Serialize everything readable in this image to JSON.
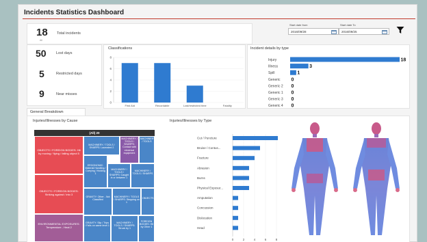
{
  "header": {
    "title": "Incidents Statistics Dashboard"
  },
  "stats": {
    "total": {
      "value": "18",
      "label": "Total incidents",
      "sub": "All"
    },
    "lost_days": {
      "value": "50",
      "label": "Lost days"
    },
    "restricted_days": {
      "value": "5",
      "label": "Restricted days"
    },
    "near_misses": {
      "value": "9",
      "label": "Near misses"
    }
  },
  "dates": {
    "start_from_label": "Start date from",
    "start_from_value": "2016/09/28",
    "start_to_label": "Start date To",
    "start_to_value": "2016/09/25"
  },
  "classifications": {
    "title": "Classifications",
    "chart_data": {
      "type": "bar",
      "categories": [
        "First Aid",
        "Recordable",
        "Lost/restricted time",
        "Fatality"
      ],
      "values": [
        7,
        7,
        3,
        0
      ],
      "ylim": [
        0,
        8
      ],
      "yticks": [
        "0",
        "2",
        "4",
        "6",
        "8"
      ]
    }
  },
  "incident_details": {
    "title": "Incident details by type",
    "chart_data": {
      "type": "bar",
      "categories": [
        "Injury",
        "Illness",
        "Spill",
        "Generic",
        "Generic 2",
        "Generic 1",
        "Generic 3",
        "Generic 4"
      ],
      "values": [
        18,
        3,
        1,
        0,
        0,
        0,
        0,
        0
      ],
      "value_labels": [
        "18",
        "3",
        "1",
        "0",
        "0",
        "0",
        "0",
        "0"
      ],
      "xlim": [
        0,
        18
      ]
    }
  },
  "general_breakdown": {
    "tab_label": "General Breakdown"
  },
  "treemap": {
    "title": "Injuries/Illnesses by Cause",
    "header": "(All) 20",
    "cells": [
      {
        "text": "OBJECTS / FOREIGN BODIES: Hit by moving / flying / falling object 5"
      },
      {
        "text": "MACHINERY / TOOLS / SHARPS: Lacerated 2"
      },
      {
        "text": "MACHINERY / TOOLS / SHARPS: Contact with electrical equipment"
      },
      {
        "text": "MACHINERY / TOOLS"
      },
      {
        "text": "OBJECTS / FOREIGN BODIES: Striking against / into 3"
      },
      {
        "text": "ERGONOMIC: Material Handling / Carrying / Holding 1"
      },
      {
        "text": "MACHINERY / TOOLS / SHARPS: Caught in or between 1"
      },
      {
        "text": "MACHINERY / TOOLS / SHARPS"
      },
      {
        "text": "GRAVITY: Other - Not Classified"
      },
      {
        "text": "MACHINERY / TOOLS / SHARPS: Stepping on 1"
      },
      {
        "text": "OBJECTS"
      },
      {
        "text": "ENVIRONMENTAL EXPOSURES: Temperature - Heat 2"
      },
      {
        "text": "GRAVITY: Slip / Trips / Falls on same level 1"
      },
      {
        "text": "MACHINERY / TOOLS / SHARPS: Struck by 1"
      },
      {
        "text": "FOREIGN BODIES: Hit by Other 1"
      }
    ]
  },
  "injuries_by_type": {
    "title": "Injuries/Illnesses by Type",
    "chart_data": {
      "type": "bar",
      "categories": [
        "Cut / Puncture",
        "Bruise / Contus...",
        "Fracture",
        "Abrasion",
        "Burns",
        "Physical Exposur...",
        "Amputation",
        "Concussion",
        "Dislocation",
        "Head"
      ],
      "values": [
        9,
        5,
        4,
        3,
        3,
        3,
        1,
        1,
        1,
        1
      ],
      "xlim": [
        0,
        10
      ],
      "xticks": [
        "0",
        "2",
        "4",
        "6",
        "8",
        "10"
      ]
    }
  }
}
